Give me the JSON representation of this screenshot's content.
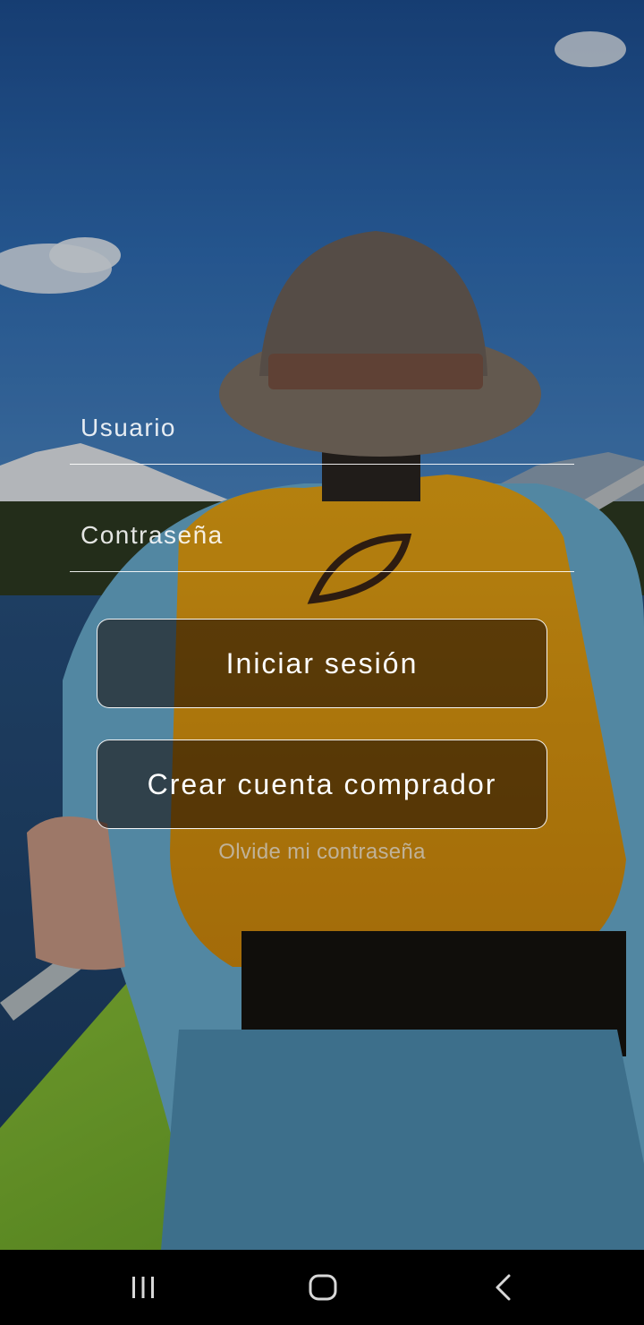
{
  "login": {
    "username_placeholder": "Usuario",
    "username_value": "",
    "password_placeholder": "Contraseña",
    "password_value": "",
    "login_button_label": "Iniciar sesión",
    "create_account_button_label": "Crear cuenta comprador",
    "forgot_password_link": "Olvide mi contraseña"
  },
  "background": {
    "description_icon": "kayaker-photo"
  },
  "navbar": {
    "recents_icon": "recents-icon",
    "home_icon": "home-icon",
    "back_icon": "back-icon"
  },
  "colors": {
    "text": "#ffffff",
    "button_border": "#ffffff",
    "link": "#c8c8c8",
    "navbar": "#000000"
  }
}
